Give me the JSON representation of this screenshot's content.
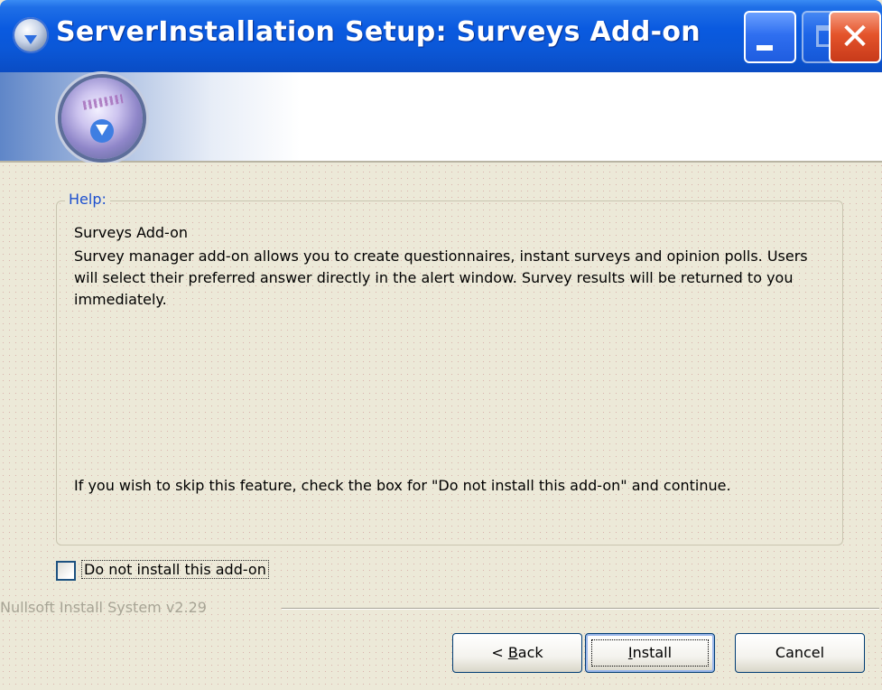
{
  "window": {
    "title": "ServerInstallation Setup: Surveys Add-on",
    "controls": {
      "close_glyph": "✕"
    }
  },
  "help": {
    "legend": "Help:",
    "title": "Surveys Add-on",
    "description": "Survey manager add-on allows you to create questionnaires, instant surveys and opinion polls. Users will select their preferred answer directly in the alert window. Survey results will be returned to you immediately.",
    "skip_note": "If you wish to skip this feature, check the box for \"Do not install this add-on\" and continue."
  },
  "option": {
    "label": "Do not install this add-on",
    "checked": false
  },
  "branding": "Nullsoft Install System v2.29",
  "buttons": {
    "back_prefix": "< ",
    "back_mnemonic": "B",
    "back_rest": "ack",
    "install_mnemonic": "I",
    "install_rest": "nstall",
    "cancel": "Cancel"
  },
  "icons": {
    "title_icon": "installer-globe-icon",
    "banner_logo": "installer-download-logo",
    "minimize": "minimize-icon",
    "maximize": "maximize-icon",
    "close": "close-icon"
  },
  "colors": {
    "titlebar": "#0a5ae0",
    "close_button": "#e4542b",
    "legend_text": "#1c4fcf",
    "window_bg": "#ece9d8"
  }
}
